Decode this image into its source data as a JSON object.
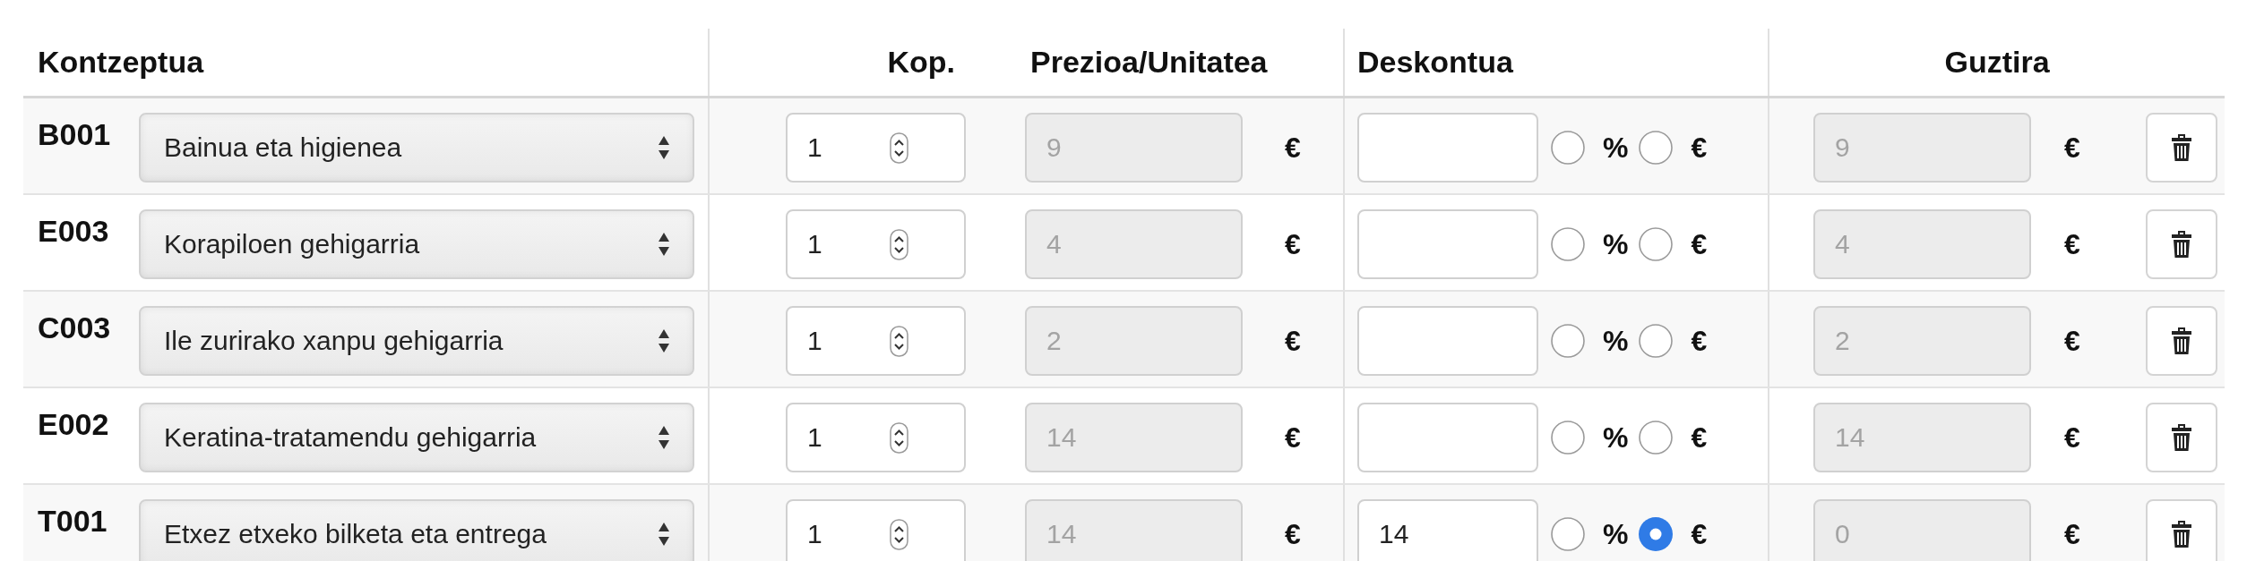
{
  "header": {
    "concept": "Kontzeptua",
    "quantity": "Kop.",
    "unit_price": "Prezioa/Unitatea",
    "discount": "Deskontua",
    "total": "Guztira"
  },
  "rows": [
    {
      "code": "B001",
      "concept": "Bainua eta higienea",
      "quantity": "1",
      "unit_price": {
        "value": "9",
        "disabled": true
      },
      "price_currency": "€",
      "discount_types": [
        {
          "label": "%",
          "selected": false
        },
        {
          "label": "€",
          "selected": false
        }
      ],
      "total": {
        "value": "9",
        "disabled": true
      },
      "total_currency": "€"
    },
    {
      "code": "E003",
      "concept": "Korapiloen gehigarria",
      "quantity": "1",
      "unit_price": {
        "value": "4",
        "disabled": true
      },
      "price_currency": "€",
      "discount_types": [
        {
          "label": "%",
          "selected": false
        },
        {
          "label": "€",
          "selected": false
        }
      ],
      "total": {
        "value": "4",
        "disabled": true
      },
      "total_currency": "€"
    },
    {
      "code": "C003",
      "concept": "Ile zurirako xanpu gehigarria",
      "quantity": "1",
      "unit_price": {
        "value": "2",
        "disabled": true
      },
      "price_currency": "€",
      "discount_types": [
        {
          "label": "%",
          "selected": false
        },
        {
          "label": "€",
          "selected": false
        }
      ],
      "total": {
        "value": "2",
        "disabled": true
      },
      "total_currency": "€"
    },
    {
      "code": "E002",
      "concept": "Keratina-tratamendu gehigarria",
      "quantity": "1",
      "unit_price": {
        "value": "14",
        "disabled": true
      },
      "price_currency": "€",
      "discount_types": [
        {
          "label": "%",
          "selected": false
        },
        {
          "label": "€",
          "selected": false
        }
      ],
      "total": {
        "value": "14",
        "disabled": true
      },
      "total_currency": "€"
    },
    {
      "code": "T001",
      "concept": "Etxez etxeko bilketa eta entrega",
      "quantity": "1",
      "unit_price": {
        "value": "14",
        "disabled": true
      },
      "price_currency": "€",
      "discount": "14",
      "discount_types": [
        {
          "label": "%",
          "selected": false
        },
        {
          "label": "€",
          "selected": true
        }
      ],
      "total": {
        "value": "0",
        "disabled": true
      },
      "total_currency": "€"
    }
  ]
}
